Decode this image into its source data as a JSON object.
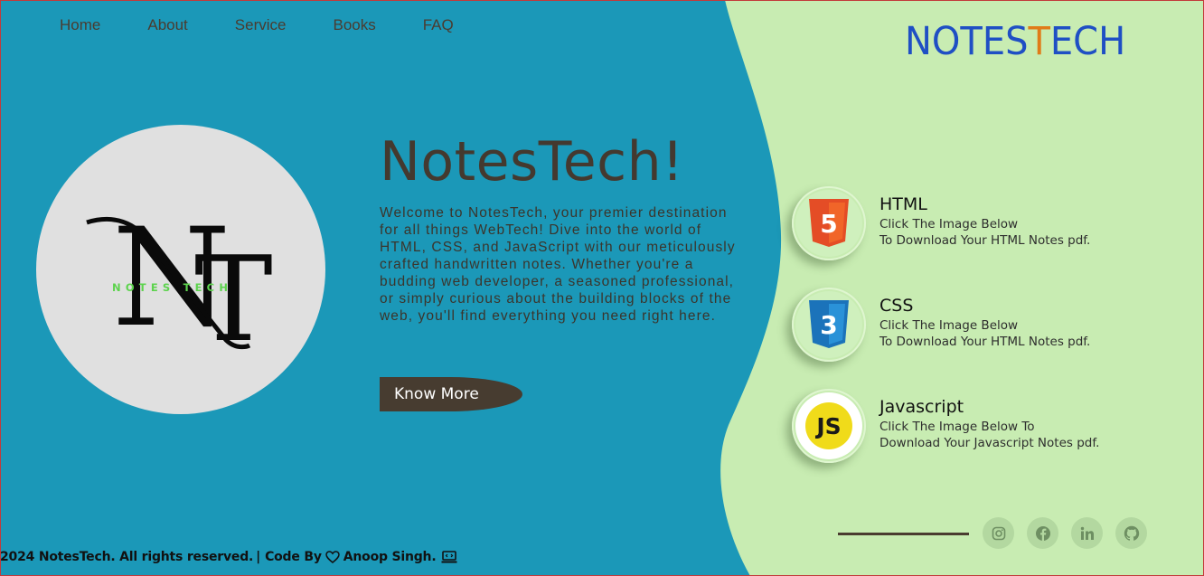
{
  "nav": {
    "items": [
      {
        "label": "Home"
      },
      {
        "label": "About"
      },
      {
        "label": "Service"
      },
      {
        "label": "Books"
      },
      {
        "label": "FAQ"
      }
    ]
  },
  "brand": {
    "part1": "NOTES",
    "accent": "T",
    "part2": "ECH"
  },
  "logo": {
    "monogram_left": "N",
    "monogram_right": "T",
    "tagline": "NOTES TECH"
  },
  "hero": {
    "title": "NotesTech!",
    "text": "Welcome to NotesTech, your premier destination for all things WebTech! Dive into the world of HTML, CSS, and JavaScript with our meticulously crafted handwritten notes. Whether you're a budding web developer, a seasoned professional, or simply curious about the building blocks of the web, you'll find everything you need right here.",
    "button": "Know More"
  },
  "notes": [
    {
      "title": "HTML",
      "line1": "Click The Image Below",
      "line2": "To Download Your HTML Notes pdf.",
      "icon": "html5-icon",
      "badge": "5"
    },
    {
      "title": "CSS",
      "line1": "Click The Image Below",
      "line2": "To Download Your HTML Notes pdf.",
      "icon": "css3-icon",
      "badge": "3"
    },
    {
      "title": "Javascript",
      "line1": "Click The Image Below To",
      "line2": "Download Your Javascript Notes pdf.",
      "icon": "javascript-icon",
      "badge": "JS"
    }
  ],
  "social": [
    "instagram-icon",
    "facebook-icon",
    "linkedin-icon",
    "github-icon"
  ],
  "footer": {
    "copyright": "2024 NotesTech. All rights reserved.",
    "separator": "|",
    "code_by": "Code By",
    "author": "Anoop Singh."
  },
  "colors": {
    "blue": "#1b98b8",
    "green": "#c8ecb2",
    "brand_blue": "#1f4fc4",
    "brand_orange": "#e07b18",
    "button": "#473c30"
  }
}
